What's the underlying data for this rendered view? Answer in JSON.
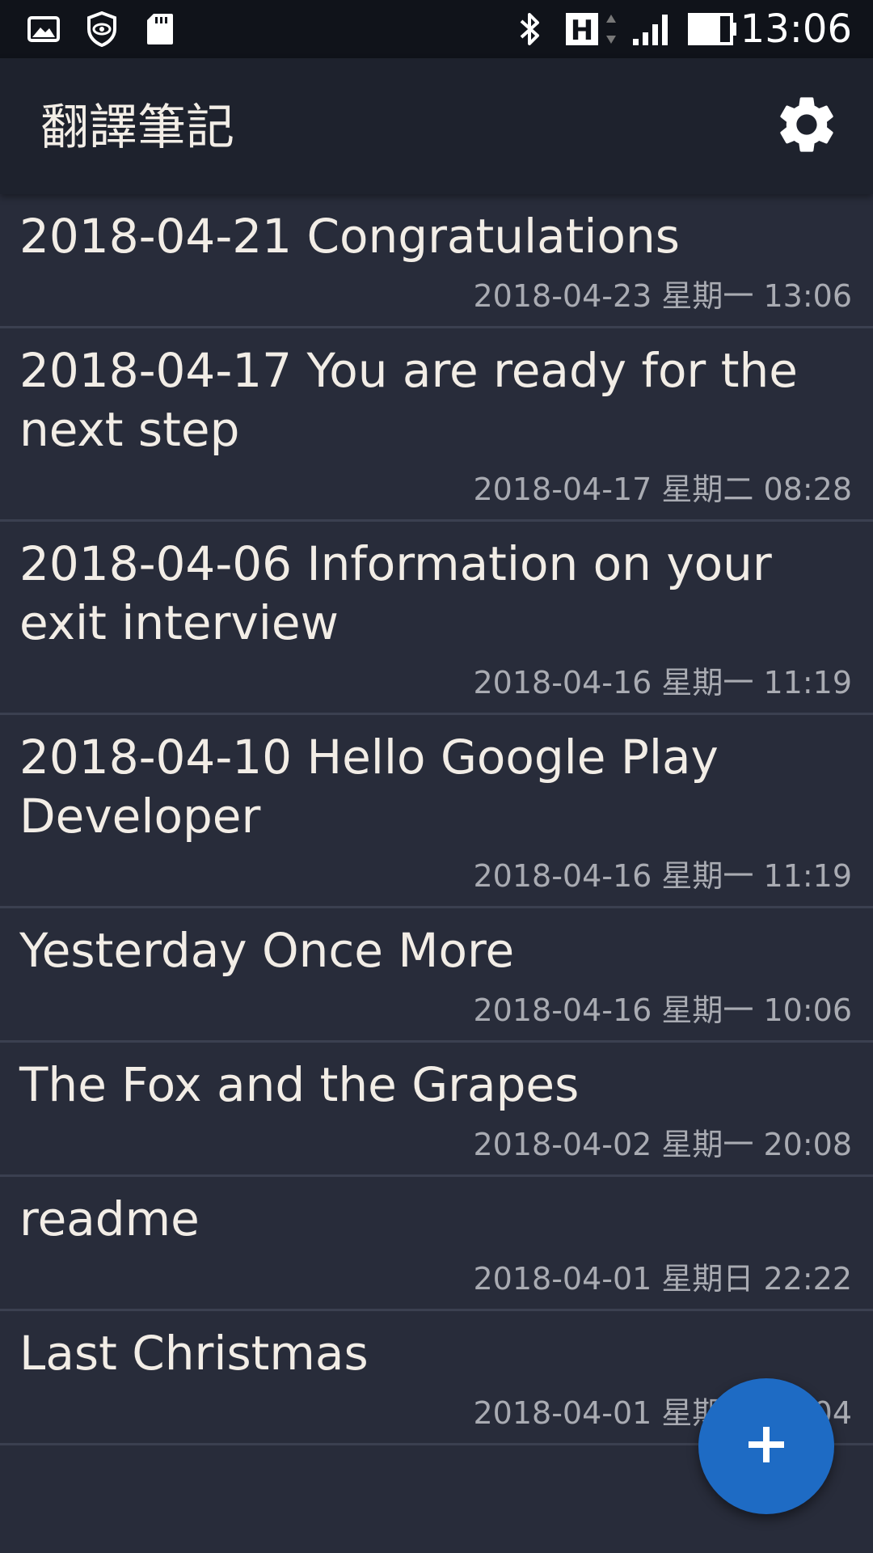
{
  "status_bar": {
    "icons": [
      "image-icon",
      "eye-shield-icon",
      "sd-card-icon",
      "bluetooth-icon",
      "network-h-icon",
      "signal-icon",
      "battery-icon"
    ],
    "time": "13:06"
  },
  "app_bar": {
    "title": "翻譯筆記",
    "settings_icon": "gear-icon"
  },
  "notes": [
    {
      "title": "2018-04-21 Congratulations",
      "date": "2018-04-23 星期一 13:06"
    },
    {
      "title": "2018-04-17 You are ready for the next step",
      "date": "2018-04-17 星期二 08:28"
    },
    {
      "title": "2018-04-06 Information on your exit interview",
      "date": "2018-04-16 星期一 11:19"
    },
    {
      "title": "2018-04-10 Hello Google Play Developer",
      "date": "2018-04-16 星期一 11:19"
    },
    {
      "title": "Yesterday Once More",
      "date": "2018-04-16 星期一 10:06"
    },
    {
      "title": "The Fox and the Grapes",
      "date": "2018-04-02 星期一 20:08"
    },
    {
      "title": "readme",
      "date": "2018-04-01 星期日 22:22"
    },
    {
      "title": "Last Christmas",
      "date": "2018-04-01 星期日 21:04"
    }
  ],
  "fab": {
    "icon": "plus-icon",
    "color": "#1e6bc4"
  },
  "colors": {
    "background": "#282c3a",
    "app_bar": "#1e222d",
    "status_bar": "#10131a",
    "title_text": "#f2ede6",
    "date_text": "#a9abb2",
    "accent": "#1e6bc4"
  }
}
